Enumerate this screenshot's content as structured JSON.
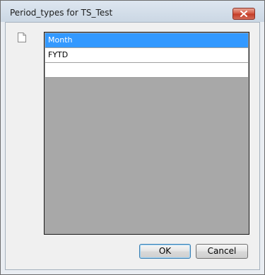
{
  "window": {
    "title": "Period_types for TS_Test"
  },
  "icons": {
    "close": "close-icon",
    "document": "document-icon"
  },
  "grid": {
    "rows": [
      {
        "label": "Month",
        "selected": true
      },
      {
        "label": "FYTD",
        "selected": false
      },
      {
        "label": "",
        "selected": false
      }
    ]
  },
  "buttons": {
    "ok_label": "OK",
    "cancel_label": "Cancel"
  },
  "colors": {
    "selection": "#3399ff",
    "grid_background": "#a8a8a8"
  }
}
